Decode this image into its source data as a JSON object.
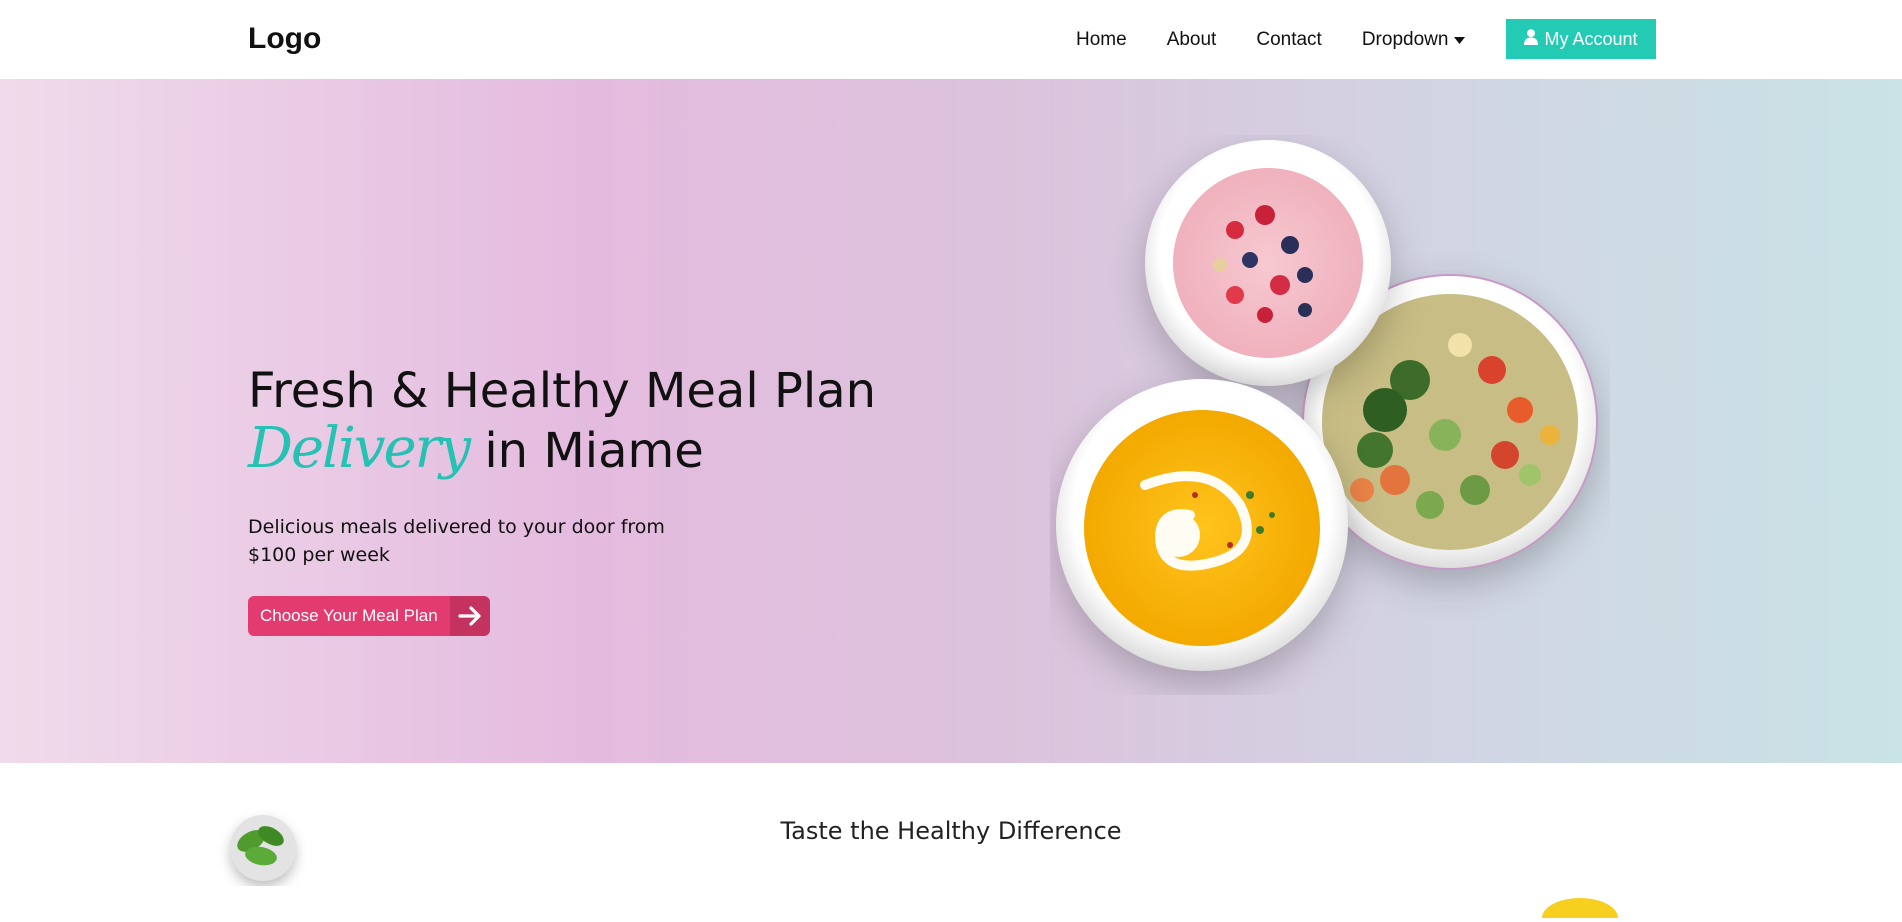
{
  "header": {
    "logo": "Logo",
    "nav": [
      "Home",
      "About",
      "Contact",
      "Dropdown"
    ],
    "account_label": "My Account"
  },
  "hero": {
    "title_line1": "Fresh & Healthy Meal Plan",
    "title_script": "Delivery",
    "title_line2_rest": "in Miame",
    "subtitle": "Delicious meals delivered to your door from $100 per week",
    "cta_label": "Choose Your Meal Plan"
  },
  "section": {
    "title": "Taste the Healthy Difference"
  },
  "colors": {
    "accent": "#24cbb4",
    "cta": "#e33b6f",
    "cta_dark": "#c4335f"
  },
  "icons": {
    "account": "user-icon",
    "dropdown": "caret-down-icon",
    "cta": "arrow-right-icon"
  }
}
